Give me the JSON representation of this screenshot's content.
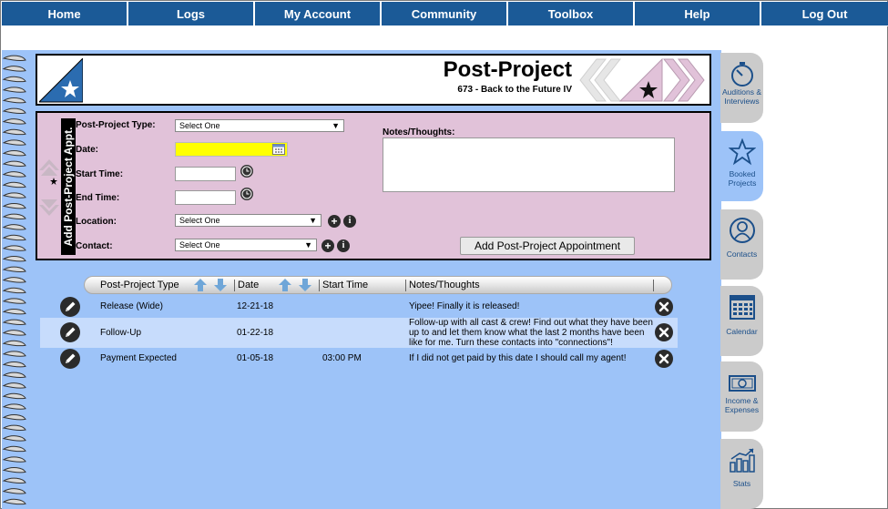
{
  "nav": [
    "Home",
    "Logs",
    "My Account",
    "Community",
    "Toolbox",
    "Help",
    "Log Out"
  ],
  "header": {
    "title": "Post-Project",
    "subtitle": "673 - Back to the Future IV"
  },
  "form": {
    "side_label": "Add Post-Project Appt.",
    "type_label": "Post-Project Type:",
    "type_value": "Select One",
    "date_label": "Date:",
    "date_value": "",
    "start_label": "Start Time:",
    "end_label": "End Time:",
    "location_label": "Location:",
    "location_value": "Select One",
    "contact_label": "Contact:",
    "contact_value": "Select One",
    "notes_label": "Notes/Thoughts:",
    "add_button": "Add Post-Project Appointment"
  },
  "table": {
    "columns": [
      "Post-Project Type",
      "Date",
      "Start Time",
      "Notes/Thoughts"
    ],
    "rows": [
      {
        "type": "Release (Wide)",
        "date": "12-21-18",
        "time": "",
        "notes": "Yipee! Finally it is released!"
      },
      {
        "type": "Follow-Up",
        "date": "01-22-18",
        "time": "",
        "notes": "Follow-up with all cast & crew! Find out what they have been up to and let them know what the last 2 months have been like for me. Turn these contacts into \"connections\"!"
      },
      {
        "type": "Payment Expected",
        "date": "01-05-18",
        "time": "03:00 PM",
        "notes": "If I did not get paid by this date I should call my agent!"
      }
    ]
  },
  "tabs": [
    {
      "label": "Auditions & Interviews",
      "icon": "stopwatch-icon"
    },
    {
      "label": "Booked Projects",
      "icon": "star-icon"
    },
    {
      "label": "Contacts",
      "icon": "person-icon"
    },
    {
      "label": "Calendar",
      "icon": "calendar-icon"
    },
    {
      "label": "Income & Expenses",
      "icon": "money-icon"
    },
    {
      "label": "Stats",
      "icon": "bar-chart-icon"
    }
  ],
  "colors": {
    "nav": "#1b5a97",
    "notebook": "#9dc3f8",
    "form_panel": "#e1c2d9",
    "date_highlight": "#ffff00",
    "tab_inactive": "#cbcbcb"
  }
}
